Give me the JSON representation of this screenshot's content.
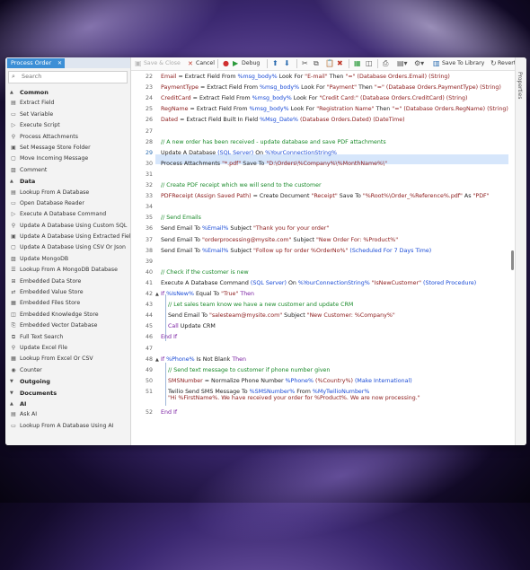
{
  "sidebar": {
    "tab_label": "Process Order",
    "close": "✕",
    "search_placeholder": "Search",
    "groups": [
      {
        "name": "Common",
        "caret": "▲",
        "items": [
          "Extract Field",
          "Set Variable",
          "Execute Script",
          "Process Attachments",
          "Set Message Store Folder",
          "Move Incoming Message",
          "Comment"
        ]
      },
      {
        "name": "Data",
        "caret": "▲",
        "items": [
          "Lookup From A Database",
          "Open Database Reader",
          "Execute A Database Command",
          "Update A Database Using Custom SQL",
          "Update A Database Using Extracted Fields",
          "Update A Database Using CSV Or Json",
          "Update MongoDB",
          "Lookup From A MongoDB Database",
          "Embedded Data Store",
          "Embedded Value Store",
          "Embedded Files Store",
          "Embedded Knowledge Store",
          "Embedded Vector Database",
          "Full Text Search",
          "Update Excel File",
          "Lookup From Excel Or CSV",
          "Counter"
        ]
      },
      {
        "name": "Outgoing",
        "caret": "▼",
        "items": []
      },
      {
        "name": "Documents",
        "caret": "▼",
        "items": []
      },
      {
        "name": "AI",
        "caret": "▲",
        "items": [
          "Ask AI",
          "Lookup From A Database Using AI"
        ]
      }
    ]
  },
  "toolbar": {
    "save_close": "Save & Close",
    "cancel": "Cancel",
    "debug": "Debug",
    "save_library": "Save To Library",
    "revert": "Revert"
  },
  "props_label": "Properties",
  "colors": {
    "accent": "#3c8fd6",
    "highlight": "#d6e6fb",
    "comment": "#1a8a2a",
    "variable": "#1a4bd6",
    "string": "#c0392b"
  },
  "lines": [
    {
      "n": "22",
      "html": "<span class='m'>Email</span> = Extract Field From <span class='b'>%msg_body%</span> Look For <span class='m'>\"E-mail\"</span> Then <span class='m'>\"=\"</span> <span class='m'>(Database Orders.Email) (String)</span>"
    },
    {
      "n": "23",
      "html": "<span class='m'>PaymentType</span> = Extract Field From <span class='b'>%msg_body%</span> Look For <span class='m'>\"Payment\"</span> Then <span class='m'>\"=\"</span> <span class='m'>(Database Orders.PaymentType) (String)</span>"
    },
    {
      "n": "24",
      "html": "<span class='m'>CreditCard</span> = Extract Field From <span class='b'>%msg_body%</span> Look For <span class='m'>\"Credit Card:\"</span> <span class='m'>(Database Orders.CreditCard) (String)</span>"
    },
    {
      "n": "25",
      "html": "<span class='m'>RegName</span> = Extract Field From <span class='b'>%msg_body%</span> Look For <span class='m'>\"Registration Name\"</span> Then <span class='m'>\"=\"</span> <span class='m'>(Database Orders.RegName) (String)</span>"
    },
    {
      "n": "26",
      "html": "<span class='m'>Dated</span> = Extract Field Built In Field <span class='b'>%Msg_Date%</span> <span class='m'>(Database Orders.Dated) (DateTime)</span>"
    },
    {
      "n": "27",
      "html": ""
    },
    {
      "n": "28",
      "html": "<span class='g'>// A new order has been received - update database and save PDF attachments</span>"
    },
    {
      "n": "29",
      "html": "Update A Database <span class='b'>(SQL Server)</span> On <span class='b'>%YourConnectionString%</span>"
    },
    {
      "n": "30",
      "html": "Process Attachments <span class='m'>\"*.pdf\"</span> Save To <span class='m'>\"D:\\Orders\\%Company%\\%MonthName%\\\"</span>"
    },
    {
      "n": "31",
      "html": ""
    },
    {
      "n": "32",
      "html": "<span class='g'>// Create PDF receipt which we will send to the customer</span>"
    },
    {
      "n": "33",
      "html": "<span class='m'>PDFReceipt (Assign Saved Path)</span> = Create Document <span class='m'>\"Receipt\"</span> Save To <span class='m'>\"%Root%\\Order_%Reference%.pdf\"</span> As <span class='m'>\"PDF\"</span>"
    },
    {
      "n": "34",
      "html": ""
    },
    {
      "n": "35",
      "html": "<span class='g'>// Send Emails</span>"
    },
    {
      "n": "36",
      "html": "Send Email To <span class='b'>%Email%</span> Subject <span class='m'>\"Thank you for your order\"</span>"
    },
    {
      "n": "37",
      "html": "Send Email To <span class='m'>\"orderprocessing@mysite.com\"</span> Subject <span class='m'>\"New Order For: %Product%\"</span>"
    },
    {
      "n": "38",
      "html": "Send Email To <span class='b'>%Email%</span> Subject <span class='m'>\"Follow up for order %OrderNo%\"</span> <span class='b'>(Scheduled For 7 Days Time)</span>"
    },
    {
      "n": "39",
      "html": ""
    },
    {
      "n": "40",
      "html": "<span class='g'>// Check if the customer is new</span>"
    },
    {
      "n": "41",
      "html": "Execute A Database Command <span class='b'>(SQL Server)</span> On <span class='b'>%YourConnectionString%</span> <span class='m'>\"IsNewCustomer\"</span> <span class='b'>(Stored Procedure)</span>"
    },
    {
      "n": "42",
      "html": "<span class='p'>If</span> <span class='b'>%IsNew%</span> Equal To <span class='m'>\"True\"</span> <span class='p'>Then</span>"
    },
    {
      "n": "43",
      "html": "&nbsp;&nbsp;&nbsp;&nbsp;<span class='g'>// Let sales team know we have a new customer and update CRM</span>"
    },
    {
      "n": "44",
      "html": "&nbsp;&nbsp;&nbsp;&nbsp;Send Email To <span class='m'>\"salesteam@mysite.com\"</span> Subject <span class='m'>\"New Customer: %Company%\"</span>"
    },
    {
      "n": "45",
      "html": "&nbsp;&nbsp;&nbsp;&nbsp;<span class='p'>Call</span> Update CRM"
    },
    {
      "n": "46",
      "html": "<span class='p'>End If</span>"
    },
    {
      "n": "47",
      "html": ""
    },
    {
      "n": "48",
      "html": "<span class='p'>If</span> <span class='b'>%Phone%</span> Is Not Blank <span class='p'>Then</span>"
    },
    {
      "n": "49",
      "html": "&nbsp;&nbsp;&nbsp;&nbsp;<span class='g'>// Send text message to customer if phone number given</span>"
    },
    {
      "n": "50",
      "html": "&nbsp;&nbsp;&nbsp;&nbsp;<span class='m'>SMSNumber</span> = Normalize Phone Number <span class='b'>%Phone%</span> <span class='m'>(%Country%)</span> <span class='b'>(Make International)</span>"
    },
    {
      "n": "51",
      "html": "&nbsp;&nbsp;&nbsp;&nbsp;Twilio Send SMS Message To <span class='b'>%SMSNumber%</span> From <span class='b'>%MyTwilioNumber%</span><br>&nbsp;&nbsp;&nbsp;&nbsp;<span class='m'>\"Hi %FirstName%. We have received your order for %Product%. We are now processing.\"</span>"
    },
    {
      "n": "52",
      "html": "<span class='p'>End If</span>"
    }
  ]
}
